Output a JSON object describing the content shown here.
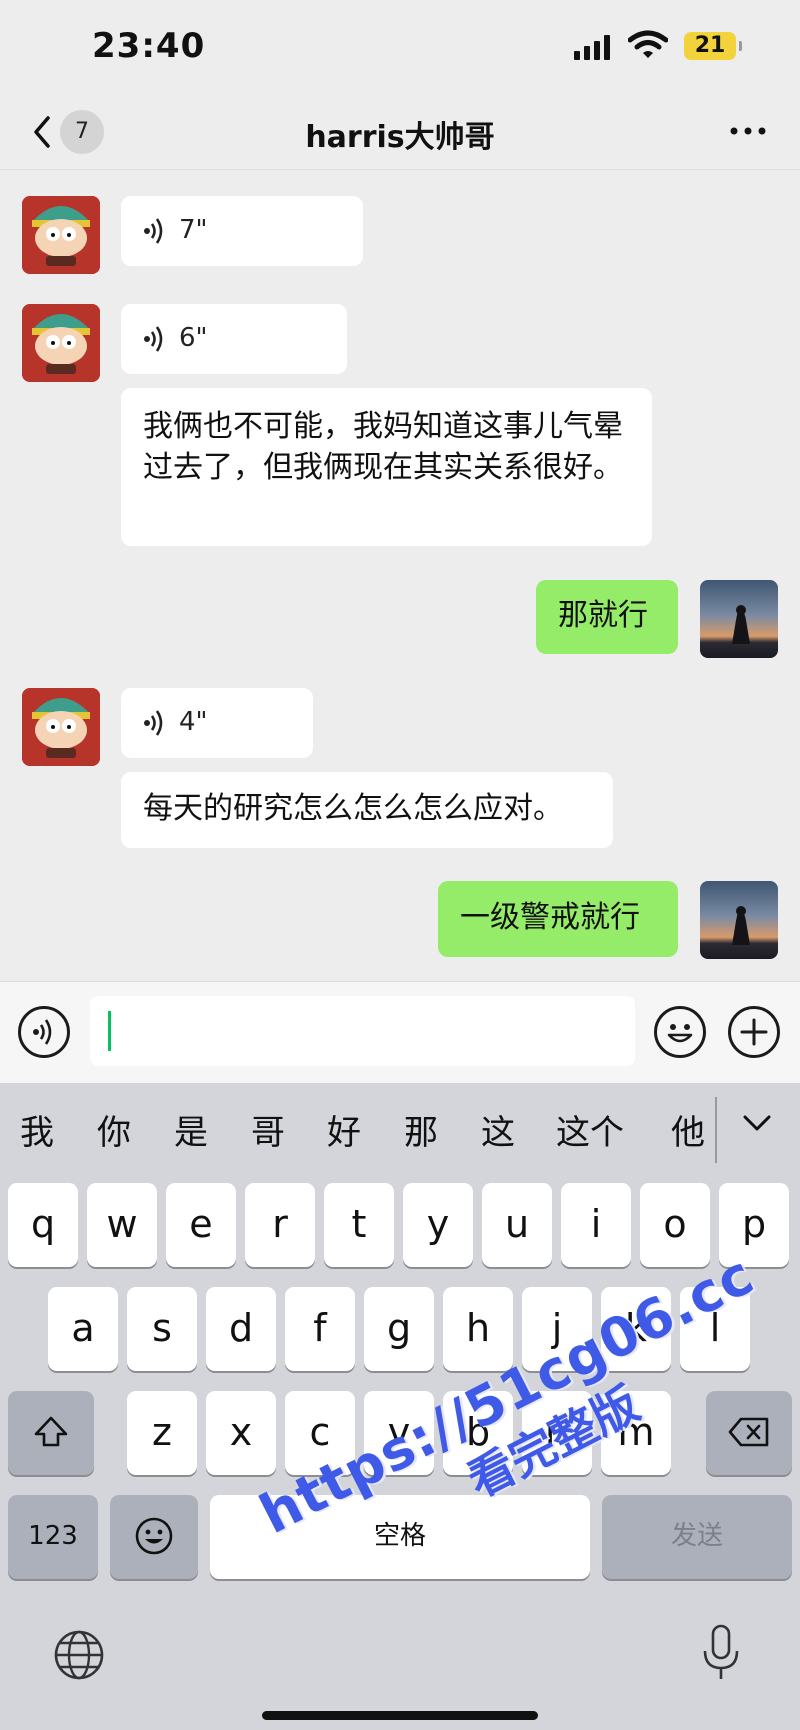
{
  "status_bar": {
    "time": "23:40",
    "battery": "21"
  },
  "nav": {
    "unread_count": "7",
    "title": "harris大帅哥"
  },
  "messages": {
    "m1_duration": "7\"",
    "m2_duration": "6\"",
    "m3_text": "我俩也不可能，我妈知道这事儿气晕过去了，但我俩现在其实关系很好。",
    "m4_text": "那就行",
    "m5_duration": "4\"",
    "m6_text": "每天的研究怎么怎么怎么应对。",
    "m7_text": "一级警戒就行"
  },
  "input": {
    "value": ""
  },
  "keyboard": {
    "candidates": [
      "我",
      "你",
      "是",
      "哥",
      "好",
      "那",
      "这",
      "这个",
      "他"
    ],
    "row1": [
      "q",
      "w",
      "e",
      "r",
      "t",
      "y",
      "u",
      "i",
      "o",
      "p"
    ],
    "row2": [
      "a",
      "s",
      "d",
      "f",
      "g",
      "h",
      "j",
      "k",
      "l"
    ],
    "row3": [
      "z",
      "x",
      "c",
      "v",
      "b",
      "n",
      "m"
    ],
    "numbers_label": "123",
    "space_label": "空格",
    "send_label": "发送"
  },
  "watermark": {
    "url": "https://51cg06.cc",
    "text": "看完整版"
  },
  "colors": {
    "my_bubble": "#95ec69",
    "their_bubble": "#ffffff",
    "accent": "#07c160",
    "watermark": "#3f5ae6"
  },
  "icons": [
    "back-chevron-icon",
    "more-icon",
    "voice-icon",
    "emoji-icon",
    "plus-icon",
    "shift-icon",
    "backspace-icon",
    "globe-icon",
    "mic-icon",
    "chevron-down-icon"
  ]
}
